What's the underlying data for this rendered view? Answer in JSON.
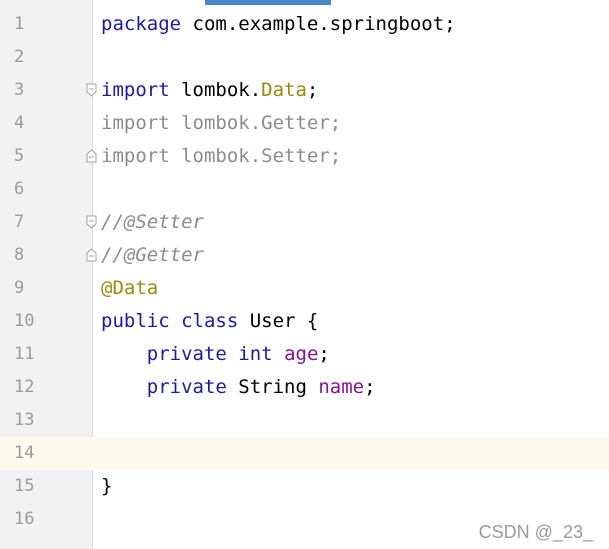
{
  "editor": {
    "lines": [
      {
        "n": "1"
      },
      {
        "n": "2"
      },
      {
        "n": "3"
      },
      {
        "n": "4"
      },
      {
        "n": "5"
      },
      {
        "n": "6"
      },
      {
        "n": "7"
      },
      {
        "n": "8"
      },
      {
        "n": "9"
      },
      {
        "n": "10"
      },
      {
        "n": "11"
      },
      {
        "n": "12"
      },
      {
        "n": "13"
      },
      {
        "n": "14"
      },
      {
        "n": "15"
      },
      {
        "n": "16"
      }
    ],
    "code": {
      "l1_kw": "package",
      "l1_rest": " com.example.springboot;",
      "l3_kw": "import",
      "l3_pkg": " lombok.",
      "l3_cls": "Data",
      "l3_semi": ";",
      "l4_text": "import lombok.Getter;",
      "l5_text": "import lombok.Setter;",
      "l7_comment": "//@Setter",
      "l8_comment": "//@Getter",
      "l9_ann": "@Data",
      "l10_kw": "public class",
      "l10_rest": " User {",
      "l11_indent": "    ",
      "l11_kw1": "private",
      "l11_sp1": " ",
      "l11_kw2": "int",
      "l11_sp2": " ",
      "l11_field": "age",
      "l11_semi": ";",
      "l12_indent": "    ",
      "l12_kw": "private",
      "l12_type": " String ",
      "l12_field": "name",
      "l12_semi": ";",
      "l15_brace": "}"
    },
    "current_line": "14"
  },
  "watermark": "CSDN @_23_",
  "colors": {
    "keyword": "#1a1aa6",
    "annotation": "#9e880d",
    "field": "#871094",
    "comment": "#8c8c8c",
    "current_line_bg": "#fcfaed"
  }
}
